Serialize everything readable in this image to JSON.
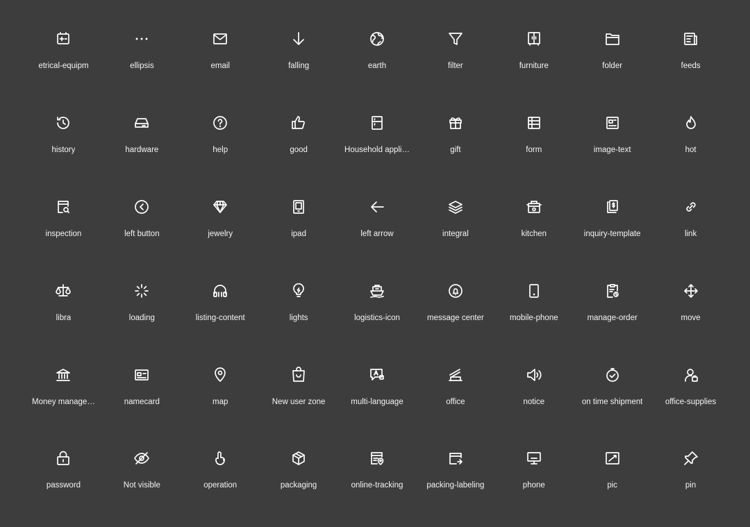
{
  "icons": [
    {
      "name": "electrical-equipment-icon",
      "label": "etrical-equipm"
    },
    {
      "name": "ellipsis-icon",
      "label": "ellipsis"
    },
    {
      "name": "email-icon",
      "label": "email"
    },
    {
      "name": "falling-icon",
      "label": "falling"
    },
    {
      "name": "earth-icon",
      "label": "earth"
    },
    {
      "name": "filter-icon",
      "label": "filter"
    },
    {
      "name": "furniture-icon",
      "label": "furniture"
    },
    {
      "name": "folder-icon",
      "label": "folder"
    },
    {
      "name": "feeds-icon",
      "label": "feeds"
    },
    {
      "name": "history-icon",
      "label": "history"
    },
    {
      "name": "hardware-icon",
      "label": "hardware"
    },
    {
      "name": "help-icon",
      "label": "help"
    },
    {
      "name": "good-icon",
      "label": "good"
    },
    {
      "name": "household-appliance-icon",
      "label": "Household appli…"
    },
    {
      "name": "gift-icon",
      "label": "gift"
    },
    {
      "name": "form-icon",
      "label": "form"
    },
    {
      "name": "image-text-icon",
      "label": "image-text"
    },
    {
      "name": "hot-icon",
      "label": "hot"
    },
    {
      "name": "inspection-icon",
      "label": "inspection"
    },
    {
      "name": "left-button-icon",
      "label": "left button"
    },
    {
      "name": "jewelry-icon",
      "label": "jewelry"
    },
    {
      "name": "ipad-icon",
      "label": "ipad"
    },
    {
      "name": "left-arrow-icon",
      "label": "left arrow"
    },
    {
      "name": "integral-icon",
      "label": "integral"
    },
    {
      "name": "kitchen-icon",
      "label": "kitchen"
    },
    {
      "name": "inquiry-template-icon",
      "label": "inquiry-template"
    },
    {
      "name": "link-icon",
      "label": "link"
    },
    {
      "name": "libra-icon",
      "label": "libra"
    },
    {
      "name": "loading-icon",
      "label": "loading"
    },
    {
      "name": "listing-content-icon",
      "label": "listing-content"
    },
    {
      "name": "lights-icon",
      "label": "lights"
    },
    {
      "name": "logistics-icon",
      "label": "logistics-icon"
    },
    {
      "name": "message-center-icon",
      "label": "message center"
    },
    {
      "name": "mobile-phone-icon",
      "label": "mobile-phone"
    },
    {
      "name": "manage-order-icon",
      "label": "manage-order"
    },
    {
      "name": "move-icon",
      "label": "move"
    },
    {
      "name": "money-management-icon",
      "label": "Money manage…"
    },
    {
      "name": "namecard-icon",
      "label": "namecard"
    },
    {
      "name": "map-icon",
      "label": "map"
    },
    {
      "name": "new-user-zone-icon",
      "label": "New user zone"
    },
    {
      "name": "multi-language-icon",
      "label": "multi-language"
    },
    {
      "name": "office-icon",
      "label": "office"
    },
    {
      "name": "notice-icon",
      "label": "notice"
    },
    {
      "name": "on-time-shipment-icon",
      "label": "on time shipment"
    },
    {
      "name": "office-supplies-icon",
      "label": "office-supplies"
    },
    {
      "name": "password-icon",
      "label": "password"
    },
    {
      "name": "not-visible-icon",
      "label": "Not visible"
    },
    {
      "name": "operation-icon",
      "label": "operation"
    },
    {
      "name": "packaging-icon",
      "label": "packaging"
    },
    {
      "name": "online-tracking-icon",
      "label": "online-tracking"
    },
    {
      "name": "packing-labeling-icon",
      "label": "packing-labeling"
    },
    {
      "name": "phone-icon",
      "label": "phone"
    },
    {
      "name": "pic-icon",
      "label": "pic"
    },
    {
      "name": "pin-icon",
      "label": "pin"
    }
  ]
}
